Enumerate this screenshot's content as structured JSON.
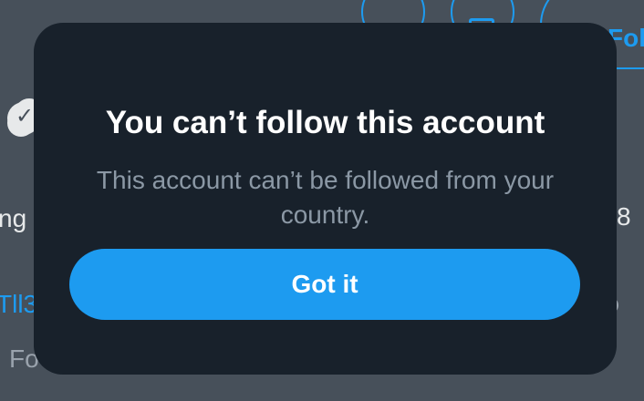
{
  "background": {
    "follow_button_label_fragment": "Follo",
    "stat_fragment_left": "ng",
    "stat_fragment_right": "8",
    "link_fragment": "Tll3",
    "meta_fragment": "Fo"
  },
  "modal": {
    "title": "You can’t follow this account",
    "body": "This account can’t be followed from your country.",
    "primary_button_label": "Got it"
  },
  "colors": {
    "accent": "#1d9bf0",
    "modal_background": "#18212b",
    "overlay": "#47505a",
    "body_text": "#8b98a5"
  },
  "icons": [
    "verified-badge-icon",
    "mail-icon",
    "more-icon"
  ]
}
